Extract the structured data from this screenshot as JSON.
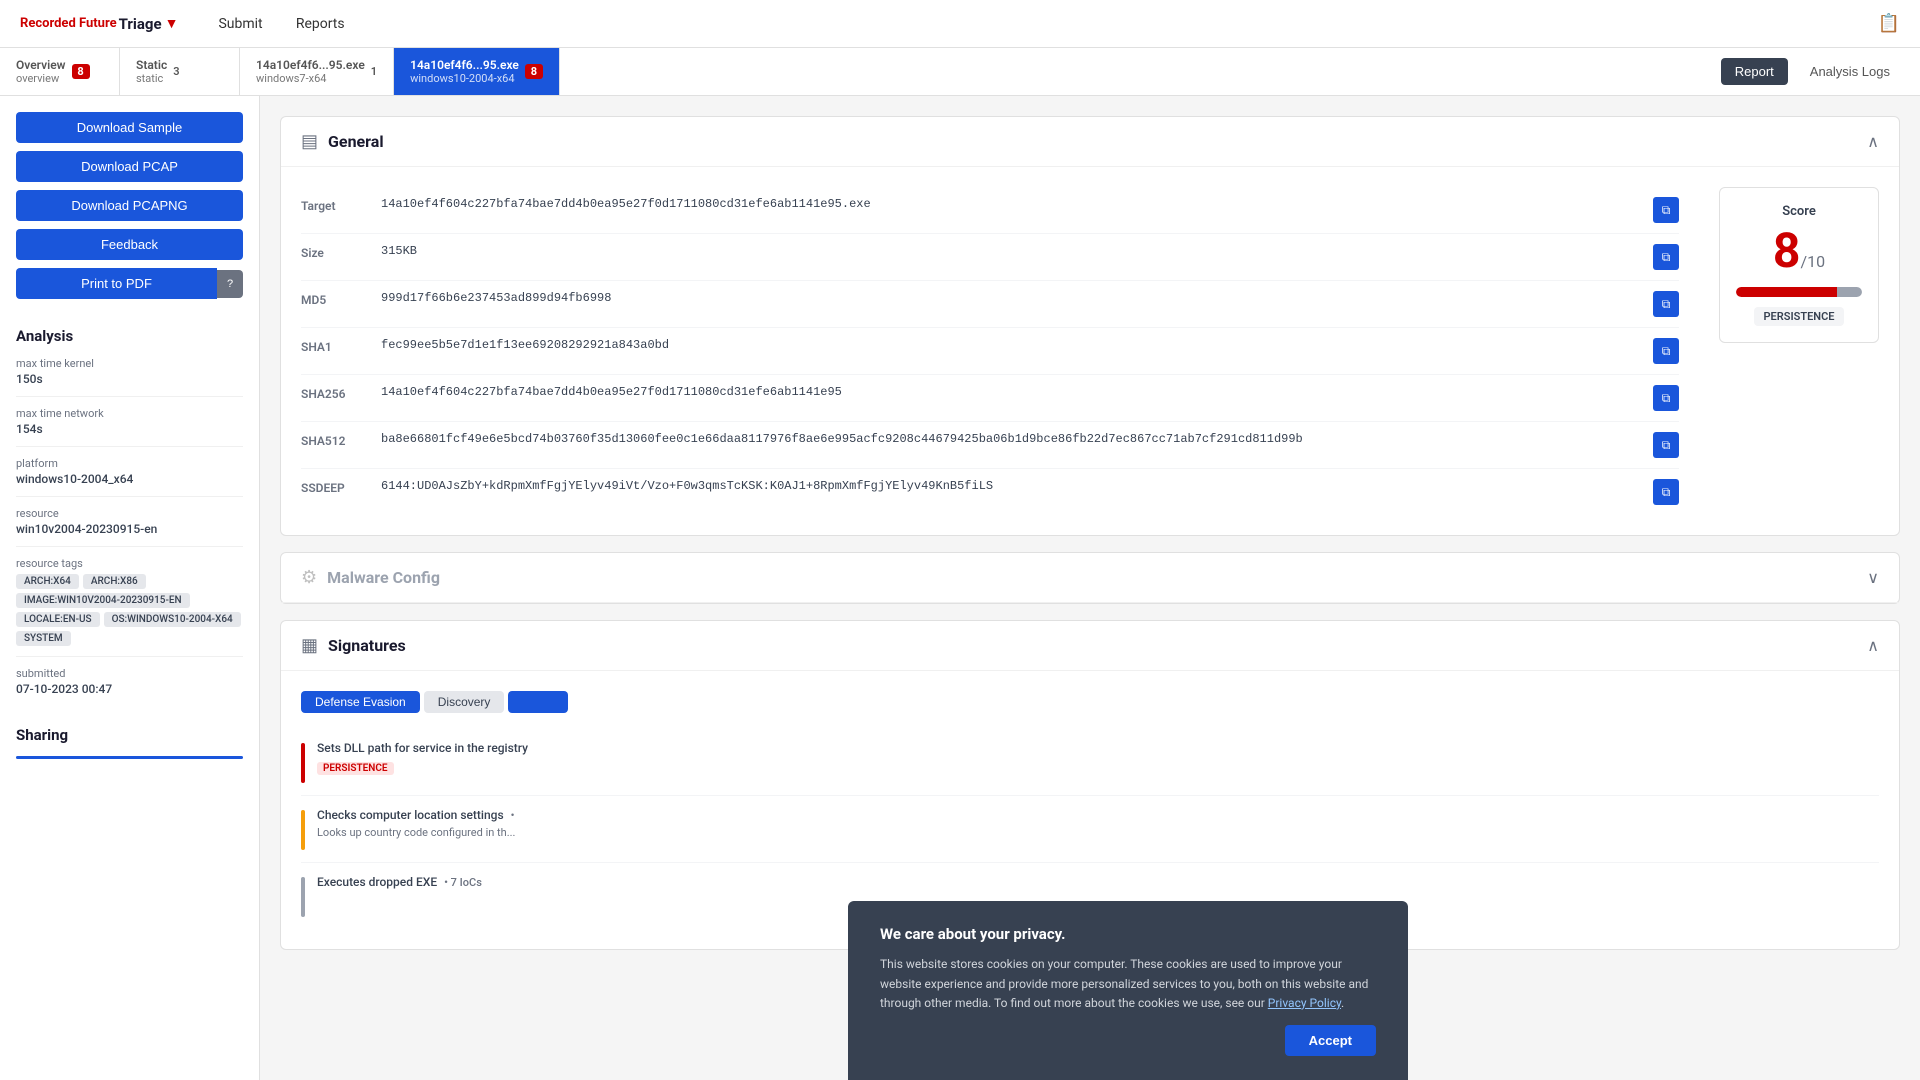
{
  "header": {
    "logo_text": "Recorded Future",
    "triage_label": "Triage",
    "nav": [
      {
        "id": "submit",
        "label": "Submit"
      },
      {
        "id": "reports",
        "label": "Reports"
      }
    ]
  },
  "tabs": [
    {
      "id": "overview",
      "main": "Overview",
      "sub": "overview",
      "badge": "8",
      "badge_color": "red",
      "active": false
    },
    {
      "id": "static",
      "main": "Static",
      "sub": "static",
      "badge": "3",
      "badge_color": "none",
      "active": false
    },
    {
      "id": "analysis1",
      "main": "14a10ef4f6...95.exe",
      "sub": "windows7-x64",
      "badge": "1",
      "badge_color": "none",
      "active": false
    },
    {
      "id": "analysis2",
      "main": "14a10ef4f6...95.exe",
      "sub": "windows10-2004-x64",
      "badge": "8",
      "badge_color": "red",
      "active": true
    }
  ],
  "toolbar": {
    "report_label": "Report",
    "analysis_logs_label": "Analysis Logs"
  },
  "sidebar": {
    "buttons": [
      {
        "id": "download-sample",
        "label": "Download Sample",
        "style": "primary"
      },
      {
        "id": "download-pcap",
        "label": "Download PCAP",
        "style": "primary"
      },
      {
        "id": "download-pcapng",
        "label": "Download PCAPNG",
        "style": "primary"
      },
      {
        "id": "feedback",
        "label": "Feedback",
        "style": "primary"
      },
      {
        "id": "print-to-pdf",
        "label": "Print to PDF",
        "style": "primary"
      }
    ],
    "analysis": {
      "title": "Analysis",
      "fields": [
        {
          "label": "max time kernel",
          "value": "150s"
        },
        {
          "label": "max time network",
          "value": "154s"
        },
        {
          "label": "platform",
          "value": "windows10-2004_x64"
        },
        {
          "label": "resource",
          "value": "win10v2004-20230915-en"
        },
        {
          "label": "resource tags",
          "value": ""
        }
      ],
      "tags": [
        "ARCH:X64",
        "ARCH:X86",
        "IMAGE:WIN10V2004-20230915-EN",
        "LOCALE:EN-US",
        "OS:WINDOWS10-2004-X64",
        "SYSTEM"
      ],
      "submitted_label": "submitted",
      "submitted_value": "07-10-2023 00:47"
    },
    "sharing": {
      "title": "Sharing"
    }
  },
  "general": {
    "title": "General",
    "fields": [
      {
        "label": "Target",
        "value": "14a10ef4f604c227bfa74bae7dd4b0ea95e27f0d1711080cd31efe6ab1141e95.exe"
      },
      {
        "label": "Size",
        "value": "315KB"
      },
      {
        "label": "MD5",
        "value": "999d17f66b6e237453ad899d94fb6998"
      },
      {
        "label": "SHA1",
        "value": "fec99ee5b5e7d1e1f13ee69208292921a843a0bd"
      },
      {
        "label": "SHA256",
        "value": "14a10ef4f604c227bfa74bae7dd4b0ea95e27f0d1711080cd31efe6ab1141e95"
      },
      {
        "label": "SHA512",
        "value": "ba8e66801fcf49e6e5bcd74b03760f35d13060fee0c1e66daa8117976f8ae6e995acfc9208c44679425ba06b1d9bce86fb22d7ec867cc71ab7cf291cd811d99b"
      },
      {
        "label": "SSDEEP",
        "value": "6144:UD0AJsZbY+kdRpmXmfFgjYElyv49iVt/Vzo+F0w3qmsTcKSK:K0AJ1+8RpmXmfFgjYElyv49KnB5fiLS"
      }
    ],
    "score": {
      "label": "Score",
      "value": "8",
      "max": "/10",
      "tag": "PERSISTENCE"
    }
  },
  "malware_config": {
    "title": "Malware Config"
  },
  "signatures": {
    "title": "Signatures",
    "tabs": [
      {
        "id": "defense-evasion",
        "label": "Defense Evasion",
        "active": true
      },
      {
        "id": "discovery",
        "label": "Discovery",
        "active": false
      },
      {
        "id": "tab3",
        "label": "",
        "active": false
      }
    ],
    "items": [
      {
        "severity": "red",
        "title": "Sets DLL path for service in the registry",
        "badge": "PERSISTENCE",
        "subtitle": ""
      },
      {
        "severity": "yellow",
        "title": "Checks computer location settings",
        "subtitle": "Looks up country code configured in th..."
      },
      {
        "severity": "gray",
        "title": "Executes dropped EXE",
        "ioc_count": "7 IoCs",
        "subtitle": ""
      }
    ]
  },
  "cookie": {
    "title": "We care about your privacy.",
    "text": "This website stores cookies on your computer. These cookies are used to improve your website experience and provide more personalized services to you, both on this website and through other media. To find out more about the cookies we use, see our",
    "link_text": "Privacy Policy",
    "accept_label": "Accept"
  }
}
